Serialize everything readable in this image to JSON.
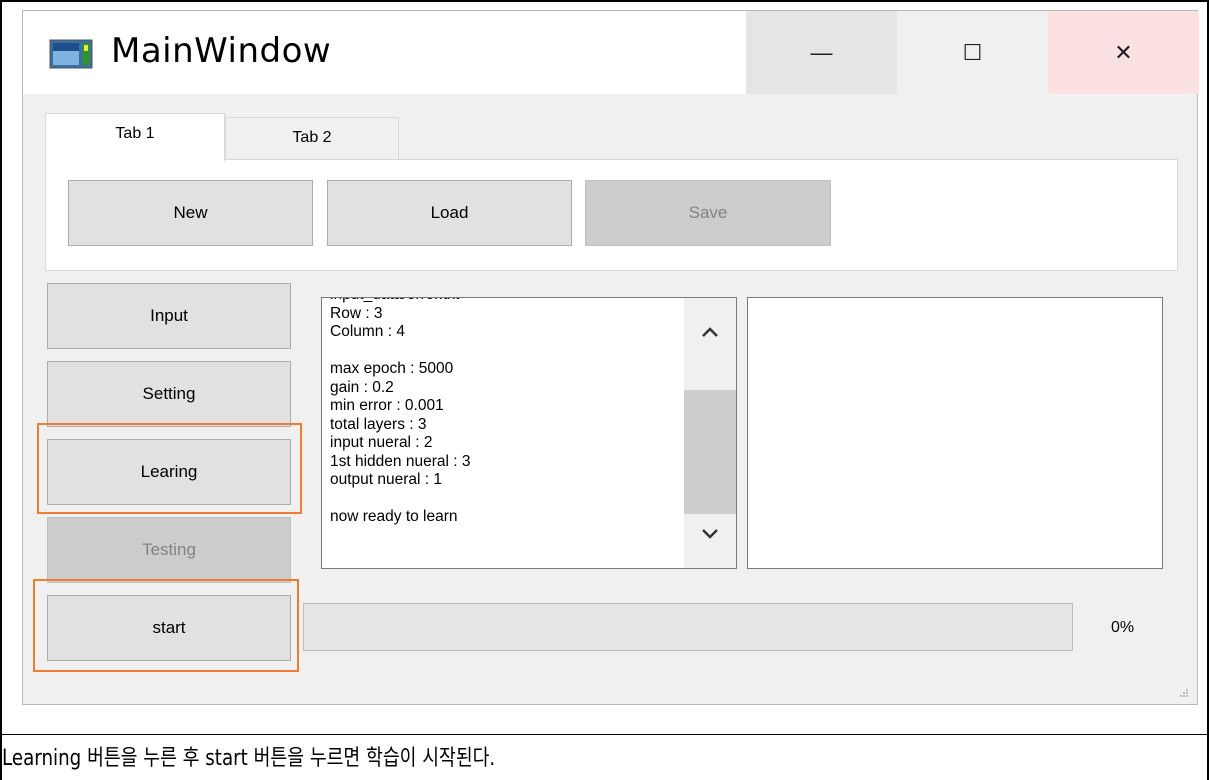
{
  "window": {
    "title": "MainWindow",
    "controls": {
      "minimize": "—",
      "maximize": "☐",
      "close": "✕"
    }
  },
  "tabs": [
    {
      "label": "Tab 1",
      "selected": true
    },
    {
      "label": "Tab 2",
      "selected": false
    }
  ],
  "toolbar": {
    "new_label": "New",
    "load_label": "Load",
    "save_label": "Save"
  },
  "sidebar": {
    "input_label": "Input",
    "setting_label": "Setting",
    "learning_label": "Learing",
    "testing_label": "Testing"
  },
  "log": {
    "lines": "input_data/error.txt\nRow : 3\nColumn : 4\n\nmax epoch : 5000\ngain : 0.2\nmin error : 0.001\ntotal layers : 3\ninput nueral : 2\n1st hidden nueral : 3\noutput nueral : 1\n\nnow ready to learn"
  },
  "start_label": "start",
  "progress": {
    "value": 0,
    "text": "0%"
  },
  "caption": "Learning 버튼을 누른 후 start 버튼을 누르면 학습이 시작된다.",
  "colors": {
    "highlight": "#ed7d31",
    "close_hover": "#fbe1e1"
  },
  "icons": [
    "app-icon",
    "minimize-icon",
    "maximize-icon",
    "close-icon",
    "chevron-up-icon",
    "chevron-down-icon",
    "resize-grip-icon"
  ]
}
